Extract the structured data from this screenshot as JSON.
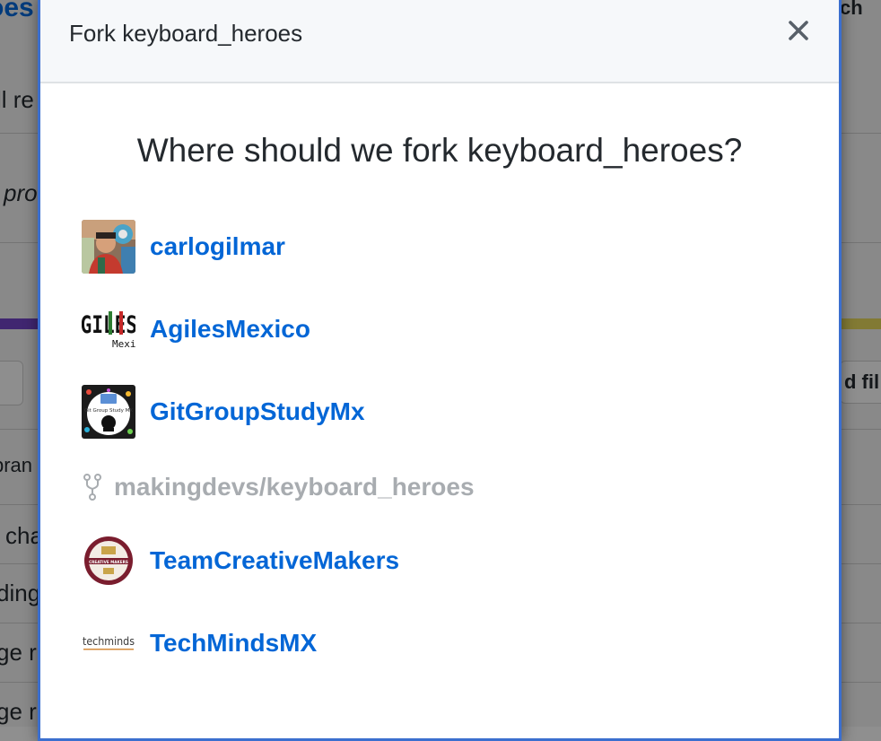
{
  "background": {
    "fragments": [
      "oes",
      "ll re",
      "pro",
      "ch",
      "d fil",
      "bran",
      "cha",
      "ding",
      "ge r",
      "ge r"
    ]
  },
  "modal": {
    "title": "Fork keyboard_heroes",
    "close_icon": "close-icon",
    "question": "Where should we fork keyboard_heroes?",
    "owners": [
      {
        "name": "carlogilmar",
        "avatar": "photo-avatar"
      },
      {
        "name": "AgilesMexico",
        "avatar_text": "AGILES",
        "avatar_sub": "Mexico"
      },
      {
        "name": "GitGroupStudyMx",
        "avatar_text": "Git Group Study MX"
      },
      {
        "name": "makingdevs/keyboard_heroes",
        "disabled": true,
        "icon": "repo-forked-icon"
      },
      {
        "name": "TeamCreativeMakers",
        "avatar_text": "CREATIVE MAKERS"
      },
      {
        "name": "TechMindsMX",
        "avatar_text": "techminds"
      }
    ]
  },
  "colors": {
    "link": "#0366d6",
    "disabled": "#a8acb0",
    "modal_border": "#3b6fcf"
  }
}
